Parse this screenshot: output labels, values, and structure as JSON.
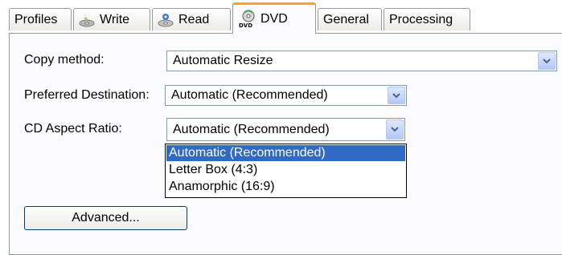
{
  "tabs": [
    {
      "label": "Profiles",
      "icon": "none"
    },
    {
      "label": "Write",
      "icon": "disc-burn-icon"
    },
    {
      "label": "Read",
      "icon": "disc-read-icon"
    },
    {
      "label": "DVD",
      "icon": "dvd-disc-icon",
      "icon_text": "DVD",
      "active": true
    },
    {
      "label": "General",
      "icon": "none"
    },
    {
      "label": "Processing",
      "icon": "none"
    }
  ],
  "form": {
    "copy_method": {
      "label": "Copy method:",
      "value": "Automatic Resize"
    },
    "preferred_destination": {
      "label": "Preferred Destination:",
      "value": "Automatic (Recommended)"
    },
    "cd_aspect_ratio": {
      "label": "CD Aspect Ratio:",
      "value": "Automatic (Recommended)",
      "options": [
        "Automatic (Recommended)",
        "Letter Box (4:3)",
        "Anamorphic (16:9)"
      ],
      "selected_index": 0
    }
  },
  "advanced_button": {
    "label": "Advanced..."
  },
  "colors": {
    "selection": "#316ac5",
    "tab_highlight": "#f5a623",
    "border": "#919b9c"
  }
}
